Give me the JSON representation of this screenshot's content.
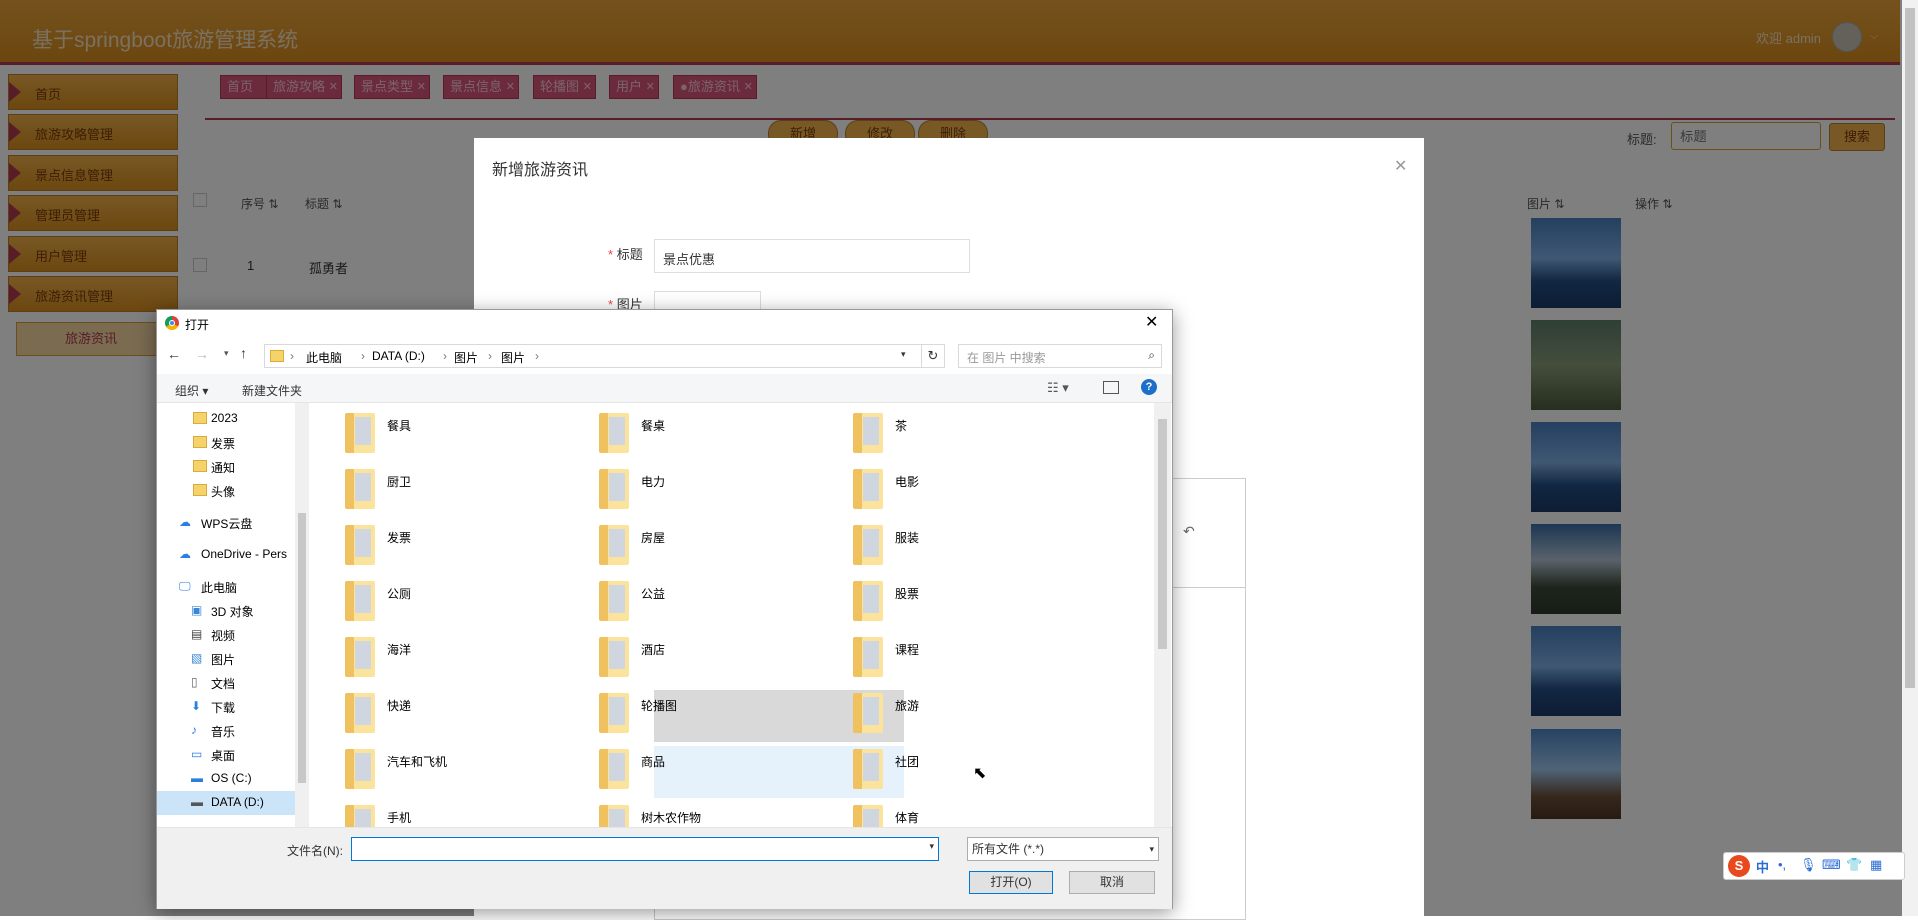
{
  "app": {
    "title": "基于springboot旅游管理系统",
    "welcome": "欢迎 admin"
  },
  "sidebar": {
    "items": [
      {
        "label": "首页"
      },
      {
        "label": "旅游攻略管理"
      },
      {
        "label": "景点信息管理"
      },
      {
        "label": "管理员管理"
      },
      {
        "label": "用户管理"
      },
      {
        "label": "旅游资讯管理"
      }
    ],
    "sub_item": "旅游资讯"
  },
  "tags": [
    {
      "label": "首页"
    },
    {
      "label": "旅游攻略"
    },
    {
      "label": "景点类型"
    },
    {
      "label": "景点信息"
    },
    {
      "label": "轮播图"
    },
    {
      "label": "用户"
    },
    {
      "label": "●旅游资讯"
    }
  ],
  "toolbar": {
    "add": "新增",
    "edit": "修改",
    "delete": "删除",
    "search_label": "标题:",
    "search_placeholder": "标题",
    "search_button": "搜索"
  },
  "table": {
    "headers": {
      "index": "序号",
      "title": "标题",
      "image": "图片",
      "actions": "操作"
    },
    "first_row": {
      "index": "1",
      "title": "孤勇者"
    },
    "thumbnails": 6
  },
  "modal": {
    "title": "新增旅游资讯",
    "title_label": "标题",
    "title_value": "景点优惠",
    "image_label": "图片"
  },
  "file_dialog": {
    "title": "打开",
    "breadcrumb": [
      "此电脑",
      "DATA (D:)",
      "图片",
      "图片"
    ],
    "search_placeholder": "在 图片 中搜索",
    "organize": "组织",
    "new_folder": "新建文件夹",
    "tree": [
      {
        "label": "2023"
      },
      {
        "label": "发票"
      },
      {
        "label": "通知"
      },
      {
        "label": "头像"
      },
      {
        "label": "WPS云盘"
      },
      {
        "label": "OneDrive - Pers"
      },
      {
        "label": "此电脑"
      },
      {
        "label": "3D 对象"
      },
      {
        "label": "视频"
      },
      {
        "label": "图片"
      },
      {
        "label": "文档"
      },
      {
        "label": "下载"
      },
      {
        "label": "音乐"
      },
      {
        "label": "桌面"
      },
      {
        "label": "OS (C:)"
      },
      {
        "label": "DATA (D:)"
      }
    ],
    "folders": [
      {
        "label": "餐具"
      },
      {
        "label": "餐桌"
      },
      {
        "label": "茶"
      },
      {
        "label": "厨卫"
      },
      {
        "label": "电力"
      },
      {
        "label": "电影"
      },
      {
        "label": "发票"
      },
      {
        "label": "房屋"
      },
      {
        "label": "服装"
      },
      {
        "label": "公厕"
      },
      {
        "label": "公益"
      },
      {
        "label": "股票"
      },
      {
        "label": "海洋"
      },
      {
        "label": "酒店"
      },
      {
        "label": "课程"
      },
      {
        "label": "快递"
      },
      {
        "label": "轮播图"
      },
      {
        "label": "旅游"
      },
      {
        "label": "汽车和飞机"
      },
      {
        "label": "商品"
      },
      {
        "label": "社团"
      },
      {
        "label": "手机"
      },
      {
        "label": "树木农作物"
      },
      {
        "label": "体育"
      }
    ],
    "filename_label": "文件名(N):",
    "filename_value": "",
    "filetype": "所有文件 (*.*)",
    "open_button": "打开(O)",
    "cancel_button": "取消"
  },
  "ime": {
    "label": "中"
  }
}
